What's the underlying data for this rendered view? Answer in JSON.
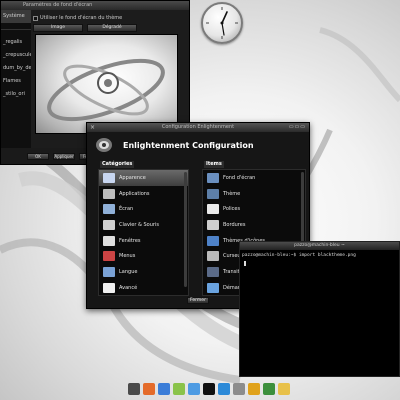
{
  "wallpaper_window": {
    "title": "Paramètres de fond d'écran",
    "sidebar": [
      {
        "label": "Système",
        "selected": true
      },
      {
        "label": "_regalis"
      },
      {
        "label": "_crepuscule"
      },
      {
        "label": "dum_by_de"
      },
      {
        "label": "Flames"
      },
      {
        "label": "_stilo_ori"
      }
    ],
    "theme_checkbox_label": "Utiliser le fond d'écran du thème",
    "tabs": [
      "Image",
      "Dégradé"
    ],
    "buttons": [
      "OK",
      "Appliquer",
      "Fermer"
    ]
  },
  "config_window": {
    "titlebar": "Configuration Enlightenment",
    "header_title": "Enlightenment Configuration",
    "categories_label": "Catégories",
    "items_label": "Items",
    "categories": [
      {
        "label": "Apparence",
        "icon": "appearance-icon",
        "color": "#c8d6f0",
        "selected": true
      },
      {
        "label": "Applications",
        "icon": "gear-icon",
        "color": "#bdbdbd"
      },
      {
        "label": "Écran",
        "icon": "monitor-icon",
        "color": "#8fb0d8"
      },
      {
        "label": "Clavier & Souris",
        "icon": "keyboard-icon",
        "color": "#d0d0d0"
      },
      {
        "label": "Fenêtres",
        "icon": "windows-icon",
        "color": "#e0e0e0"
      },
      {
        "label": "Menus",
        "icon": "menu-icon",
        "color": "#c44"
      },
      {
        "label": "Langue",
        "icon": "flag-icon",
        "color": "#7aa2d6"
      },
      {
        "label": "Avancé",
        "icon": "advanced-icon",
        "color": "#f0f0f0"
      }
    ],
    "items": [
      {
        "label": "Fond d'écran",
        "icon": "wallpaper-icon",
        "color": "#6a8fbf"
      },
      {
        "label": "Thème",
        "icon": "theme-icon",
        "color": "#5d7fa8"
      },
      {
        "label": "Polices",
        "icon": "fonts-icon",
        "color": "#eaeaea"
      },
      {
        "label": "Bordures",
        "icon": "borders-icon",
        "color": "#cfcfcf"
      },
      {
        "label": "Thèmes d'icônes",
        "icon": "icon-theme-icon",
        "color": "#4e82c8"
      },
      {
        "label": "Curseur",
        "icon": "cursor-icon",
        "color": "#bbbbbb"
      },
      {
        "label": "Transitions",
        "icon": "transitions-icon",
        "color": "#5b6b88"
      },
      {
        "label": "Démarrage",
        "icon": "startup-icon",
        "color": "#6aa3e0"
      }
    ],
    "close_label": "Fermer"
  },
  "terminal": {
    "title": "pazzo@machin-bleu ~",
    "prompt_line": "pazzo@machin-bleu:~$ import blacktheme.png"
  },
  "dock": {
    "icons": [
      {
        "name": "home-icon",
        "color": "#4a4a4a"
      },
      {
        "name": "firefox-icon",
        "color": "#e46b2a"
      },
      {
        "name": "globe-icon",
        "color": "#3b7dd8"
      },
      {
        "name": "pidgin-icon",
        "color": "#8ac34a"
      },
      {
        "name": "chat-icon",
        "color": "#4d9be3"
      },
      {
        "name": "terminal-icon",
        "color": "#111111"
      },
      {
        "name": "network-icon",
        "color": "#2c8ad8"
      },
      {
        "name": "settings-icon",
        "color": "#8c8c8c"
      },
      {
        "name": "close-app-icon",
        "color": "#e0a21b"
      },
      {
        "name": "shield-icon",
        "color": "#3c8f3c"
      },
      {
        "name": "f-spot-icon",
        "color": "#e8c14a"
      }
    ]
  }
}
